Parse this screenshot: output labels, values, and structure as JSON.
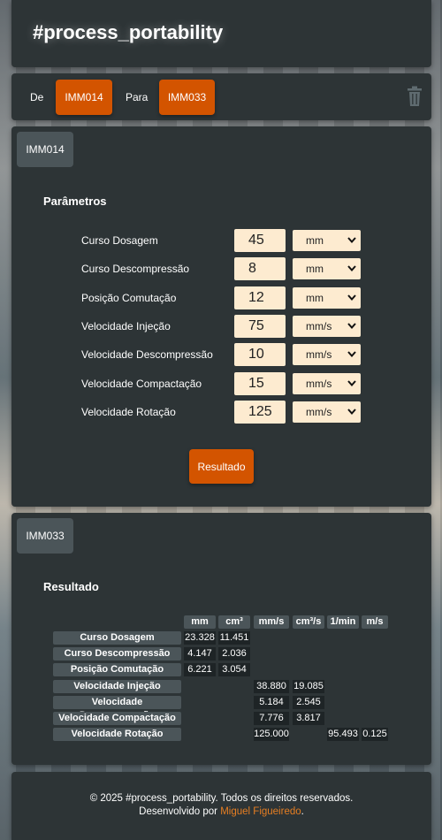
{
  "header": {
    "title": "#process_portability"
  },
  "selector": {
    "from_label": "De",
    "from_value": "IMM014",
    "to_label": "Para",
    "to_value": "IMM033",
    "delete_icon": "trash-icon"
  },
  "params_panel": {
    "tab": "IMM014",
    "title": "Parâmetros",
    "rows": [
      {
        "label": "Curso Dosagem",
        "value": "45",
        "unit": "mm"
      },
      {
        "label": "Curso Descompressão",
        "value": "8",
        "unit": "mm"
      },
      {
        "label": "Posição Comutação",
        "value": "12",
        "unit": "mm"
      },
      {
        "label": "Velocidade Injeção",
        "value": "75",
        "unit": "mm/s"
      },
      {
        "label": "Velocidade Descompressão",
        "value": "10",
        "unit": "mm/s"
      },
      {
        "label": "Velocidade Compactação",
        "value": "15",
        "unit": "mm/s"
      },
      {
        "label": "Velocidade Rotação",
        "value": "125",
        "unit": "mm/s"
      }
    ],
    "button": "Resultado"
  },
  "result_panel": {
    "tab": "IMM033",
    "title": "Resultado",
    "headers": [
      "mm",
      "cm³",
      "mm/s",
      "cm³/s",
      "1/min",
      "m/s"
    ],
    "rows": [
      {
        "label": "Curso Dosagem",
        "values": [
          "23.328",
          "11.451",
          "",
          "",
          "",
          ""
        ]
      },
      {
        "label": "Curso Descompressão",
        "values": [
          "4.147",
          "2.036",
          "",
          "",
          "",
          ""
        ]
      },
      {
        "label": "Posição Comutação",
        "values": [
          "6.221",
          "3.054",
          "",
          "",
          "",
          ""
        ]
      },
      {
        "label": "Velocidade Injeção",
        "values": [
          "",
          "",
          "38.880",
          "19.085",
          "",
          ""
        ]
      },
      {
        "label": "Velocidade Descompressão",
        "values": [
          "",
          "",
          "5.184",
          "2.545",
          "",
          ""
        ]
      },
      {
        "label": "Velocidade Compactação",
        "values": [
          "",
          "",
          "7.776",
          "3.817",
          "",
          ""
        ]
      },
      {
        "label": "Velocidade Rotação",
        "values": [
          "",
          "",
          "125.000",
          "",
          "95.493",
          "0.125"
        ]
      }
    ]
  },
  "footer": {
    "copyright": "© 2025 #process_portability. Todos os direitos reservados.",
    "dev_prefix": "Desenvolvido por ",
    "dev_name": "Miguel Figueiredo",
    "dev_suffix": "."
  },
  "colors": {
    "panel": "#2d3436",
    "accent": "#d35400",
    "input_bg": "#fdebd0",
    "tab_bg": "#4b5559",
    "link": "#e67e22"
  }
}
